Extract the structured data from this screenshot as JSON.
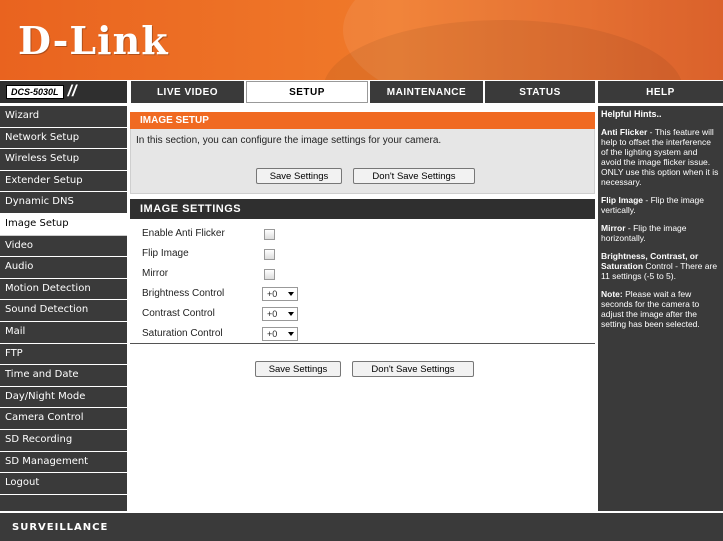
{
  "brand": {
    "logo": "D-Link",
    "model": "DCS-5030L",
    "slashes": "//"
  },
  "nav": {
    "tabs": [
      {
        "label": "LIVE VIDEO"
      },
      {
        "label": "SETUP"
      },
      {
        "label": "MAINTENANCE"
      },
      {
        "label": "STATUS"
      },
      {
        "label": "HELP"
      }
    ],
    "active_tab": "SETUP"
  },
  "sidebar": {
    "items": [
      {
        "label": "Wizard"
      },
      {
        "label": "Network Setup"
      },
      {
        "label": "Wireless Setup"
      },
      {
        "label": "Extender Setup"
      },
      {
        "label": "Dynamic DNS"
      },
      {
        "label": "Image Setup"
      },
      {
        "label": "Video"
      },
      {
        "label": "Audio"
      },
      {
        "label": "Motion Detection"
      },
      {
        "label": "Sound Detection"
      },
      {
        "label": "Mail"
      },
      {
        "label": "FTP"
      },
      {
        "label": "Time and Date"
      },
      {
        "label": "Day/Night Mode"
      },
      {
        "label": "Camera Control"
      },
      {
        "label": "SD Recording"
      },
      {
        "label": "SD Management"
      },
      {
        "label": "Logout"
      }
    ],
    "active_item": "Image Setup"
  },
  "image_setup": {
    "title": "IMAGE SETUP",
    "intro": "In this section, you can configure the image settings for your camera.",
    "save_label": "Save Settings",
    "dont_save_label": "Don't Save Settings"
  },
  "image_settings": {
    "title": "IMAGE SETTINGS",
    "anti_flicker_label": "Enable Anti Flicker",
    "anti_flicker_checked": false,
    "flip_label": "Flip Image",
    "flip_checked": false,
    "mirror_label": "Mirror",
    "mirror_checked": false,
    "brightness_label": "Brightness Control",
    "brightness_value": "+0",
    "contrast_label": "Contrast Control",
    "contrast_value": "+0",
    "saturation_label": "Saturation Control",
    "saturation_value": "+0"
  },
  "bottom_buttons": {
    "save_label": "Save Settings",
    "dont_save_label": "Don't Save Settings"
  },
  "help": {
    "heading": "Helpful Hints..",
    "anti_flicker_title": "Anti Flicker",
    "anti_flicker_text": " - This feature will help to offset the interference of the lighting system and avoid the image flicker issue. ONLY use this option when it is necessary.",
    "flip_title": "Flip Image",
    "flip_text": " - Flip the image vertically.",
    "mirror_title": "Mirror",
    "mirror_text": " - Flip the image horizontally.",
    "bcs_title": "Brightness, Contrast, or Saturation",
    "bcs_text": " Control - There are 11 settings (-5 to 5).",
    "note_title": "Note:",
    "note_text": " Please wait a few seconds for the camera to adjust the image after the setting has been selected."
  },
  "footer": {
    "label": "SURVEILLANCE"
  },
  "colors": {
    "orange": "#f06a22",
    "dark": "#3a3a3a"
  }
}
